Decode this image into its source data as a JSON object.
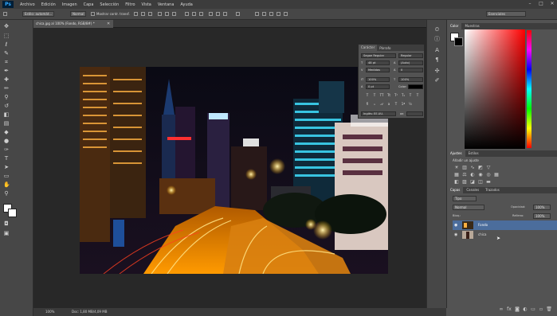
{
  "menu": {
    "logo": "Ps",
    "items": [
      "Archivo",
      "Edición",
      "Imagen",
      "Capa",
      "Selección",
      "Filtro",
      "Vista",
      "Ventana",
      "Ayuda"
    ]
  },
  "options": {
    "preset": "Estilo: automát...",
    "style": "Normal",
    "show_transform": "Mostrar contr. transf.",
    "workspace": "Esenciales"
  },
  "document": {
    "tab_title": "chica.jpg al 100% (Fondo, RGB/8#) *",
    "zoom": "100%",
    "doc_info": "Doc: 1,80 MB/4,09 MB"
  },
  "character_panel": {
    "tabs": [
      "Carácter",
      "Párrafo"
    ],
    "font_family": "Segoe Regular",
    "font_style": "Regular",
    "font_size": "48 pt",
    "leading": "(Auto)",
    "kerning": "Medidas",
    "tracking": "0",
    "vscale": "100%",
    "hscale": "100%",
    "baseline": "0 pt",
    "color_label": "Color:",
    "language": "Inglés: EE.UU.",
    "aa": "aa"
  },
  "color_panel": {
    "tabs": [
      "Color",
      "Muestras"
    ]
  },
  "adjustments_panel": {
    "tabs": [
      "Ajustes",
      "Estilos"
    ],
    "title": "Añadir un ajuste"
  },
  "layers_panel": {
    "tabs": [
      "Capas",
      "Canales",
      "Trazados"
    ],
    "kind": "Tipo",
    "blend": "Normal",
    "opacity_label": "Opacidad:",
    "opacity": "100%",
    "lock_label": "Bloq.:",
    "fill_label": "Relleno:",
    "fill": "100%",
    "layers": [
      {
        "name": "Fondo",
        "selected": true
      },
      {
        "name": "chica",
        "selected": false
      }
    ]
  }
}
